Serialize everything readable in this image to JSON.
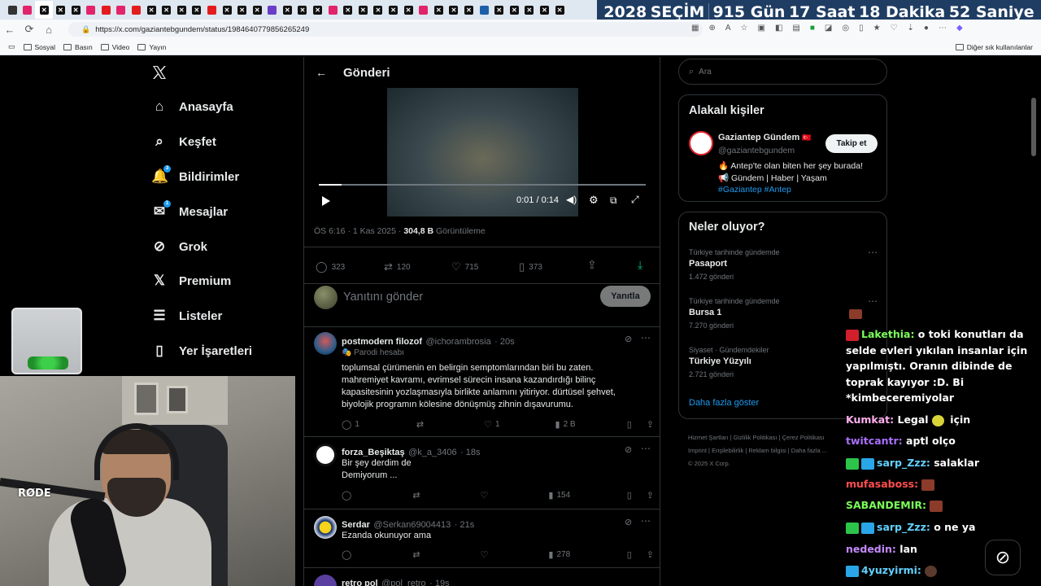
{
  "browser": {
    "tab_count": 37,
    "countdown": {
      "year": "2028",
      "label": "SEÇİM",
      "days": "915 Gün",
      "hours": "17 Saat",
      "minutes": "18 Dakika",
      "seconds": "52 Saniye"
    },
    "url": "https://x.com/gaziantebgundem/status/1984640779856265249",
    "bookmarks": [
      "Sosyal",
      "Basın",
      "Video",
      "Yayın"
    ],
    "other_bookmarks": "Diğer sık kullanılanlar"
  },
  "nav": {
    "items": [
      {
        "label": "Anasayfa",
        "icon": "home-icon"
      },
      {
        "label": "Keşfet",
        "icon": "search-icon"
      },
      {
        "label": "Bildirimler",
        "icon": "bell-icon",
        "badge": "3"
      },
      {
        "label": "Mesajlar",
        "icon": "mail-icon",
        "badge": "1"
      },
      {
        "label": "Grok",
        "icon": "grok-icon"
      },
      {
        "label": "Premium",
        "icon": "x-logo-icon"
      },
      {
        "label": "Listeler",
        "icon": "list-icon"
      },
      {
        "label": "Yer İşaretleri",
        "icon": "bookmark-icon"
      }
    ]
  },
  "post": {
    "header_title": "Gönderi",
    "video_time": "0:01 / 0:14",
    "video_progress": 0.07,
    "meta_time": "ÖS 6:16 · 1 Kas 2025 · ",
    "views": "304,8 B",
    "views_label": "Görüntüleme",
    "stats": {
      "replies": "323",
      "reposts": "120",
      "likes": "715",
      "bookmarks": "373"
    },
    "reply_placeholder": "Yanıtını gönder",
    "reply_button": "Yanıtla"
  },
  "replies": [
    {
      "name": "postmodern filozof",
      "handle": "@ichorambrosia",
      "time": "· 20s",
      "parody": "Parodi hesabı",
      "text": "toplumsal çürümenin en belirgin semptomlarından biri bu zaten. mahremiyet kavramı, evrimsel sürecin insana kazandırdığı bilinç kapasitesinin yozlaşmasıyla birlikte anlamını yitiriyor. dürtüsel şehvet, biyolojik programın kölesine dönüşmüş zihnin dışavurumu.",
      "replies": "1",
      "likes": "1",
      "views": "2 B"
    },
    {
      "name": "forza_Beşiktaş",
      "handle": "@k_a_3406",
      "time": "· 18s",
      "text1": "Bir şey derdim de",
      "text2": "Demiyorum ...",
      "views": "154"
    },
    {
      "name": "Serdar",
      "handle": "@Serkan69004413",
      "time": "· 21s",
      "text": "Ezanda okunuyor ama",
      "views": "278"
    },
    {
      "name": "retro pol",
      "handle": "@pol_retro",
      "time": "· 19s"
    }
  ],
  "sidebar": {
    "search_placeholder": "Ara",
    "related_title": "Alakalı kişiler",
    "person": {
      "name": "Gaziantep Gündem",
      "flag": "🇹🇷",
      "handle": "@gaziantebgundem",
      "follow": "Takip et",
      "bio1": "🔥 Antep'te olan biten her şey burada!",
      "bio2": "📢 Gündem | Haber | Yaşam",
      "tags": "#Gaziantep #Antep"
    },
    "trends_title": "Neler oluyor?",
    "trends": [
      {
        "category": "Türkiye tarihinde gündemde",
        "name": "Pasaport",
        "count": "1.472 gönderi"
      },
      {
        "category": "Türkiye tarihinde gündemde",
        "name": "Bursa 1",
        "count": "7.270 gönderi"
      },
      {
        "category": "Siyaset · Gündemdekiler",
        "name": "Türkiye Yüzyılı",
        "count": "2.721 gönderi"
      }
    ],
    "show_more": "Daha fazla göster",
    "footer": [
      "Hizmet Şartları",
      "Gizlilik Politikası",
      "Çerez Politikası",
      "Imprint",
      "Erişilebilirlik",
      "Reklam bilgisi",
      "Daha fazla ..."
    ],
    "copyright": "© 2025 X Corp."
  },
  "chat": [
    {
      "user": "Lakethia:",
      "color": "#7cff5a",
      "text": " o toki konutları da selde evleri yıkılan insanlar için yapılmıştı. Oranın dibinde de toprak kayıyor :D. Bi *kimbeceremiyolar"
    },
    {
      "user": "Kumkat:",
      "color": "#ffb0f0",
      "text": " Legal",
      "text2": " için"
    },
    {
      "user": "twitcantr:",
      "color": "#a970ff",
      "text": " aptl olço"
    },
    {
      "user": "sarp_Zzz:",
      "color": "#62d0ff",
      "text": " salaklar"
    },
    {
      "user": "mufasaboss:",
      "color": "#ff4d4d",
      "text": ""
    },
    {
      "user": "SABANDEMIR:",
      "color": "#7cff5a",
      "text": ""
    },
    {
      "user": "sarp_Zzz:",
      "color": "#62d0ff",
      "text": " o ne ya"
    },
    {
      "user": "nededin:",
      "color": "#c58aff",
      "text": " lan"
    },
    {
      "user": "4yuzyirmi:",
      "color": "#62d0ff",
      "text": ""
    }
  ],
  "webcam": {
    "mic_brand": "RØDE"
  }
}
